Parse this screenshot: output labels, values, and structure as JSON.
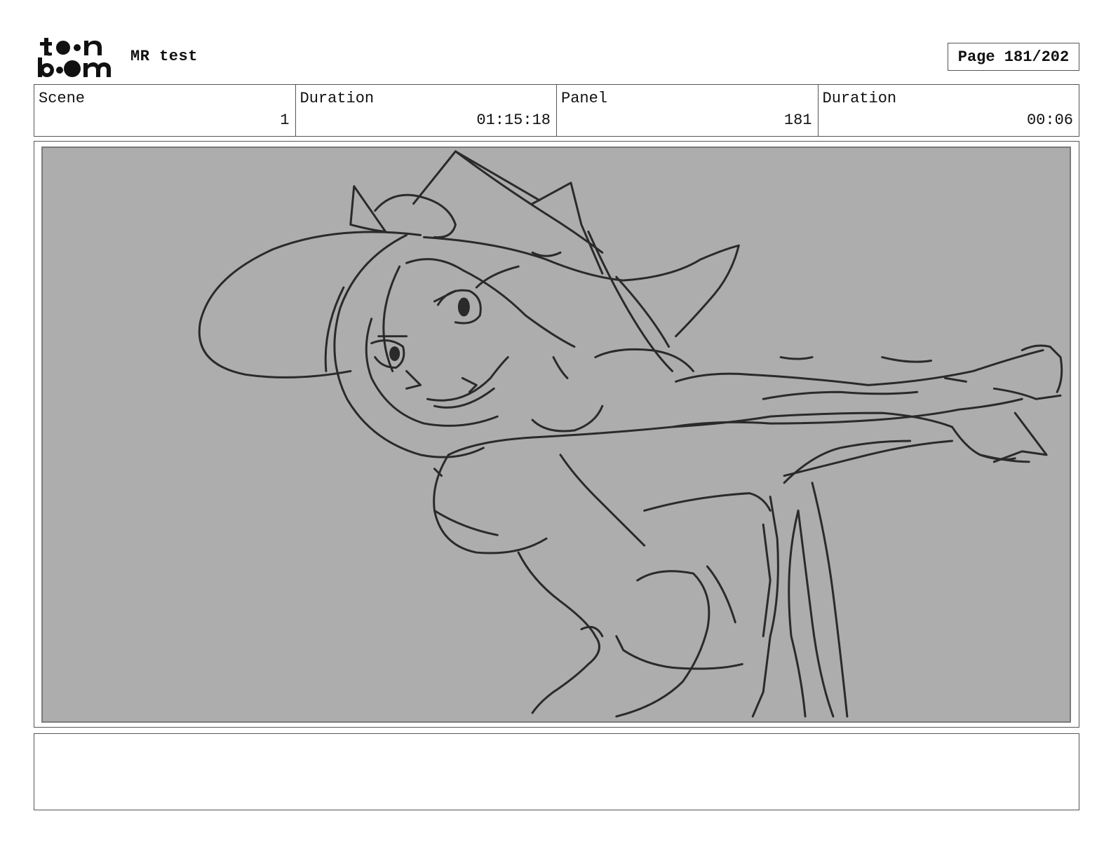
{
  "header": {
    "logo_name": "toon boom logo",
    "project_title": "MR test",
    "page_label": "Page 181/202"
  },
  "info": {
    "scene_label": "Scene",
    "scene_value": "1",
    "scene_duration_label": "Duration",
    "scene_duration_value": "01:15:18",
    "panel_label": "Panel",
    "panel_value": "181",
    "panel_duration_label": "Duration",
    "panel_duration_value": "00:06"
  },
  "panel": {
    "image_description_icon": "sketch-drawing",
    "background_color": "#adadad",
    "line_color": "#2a2a2a"
  },
  "notes": {
    "text": ""
  }
}
